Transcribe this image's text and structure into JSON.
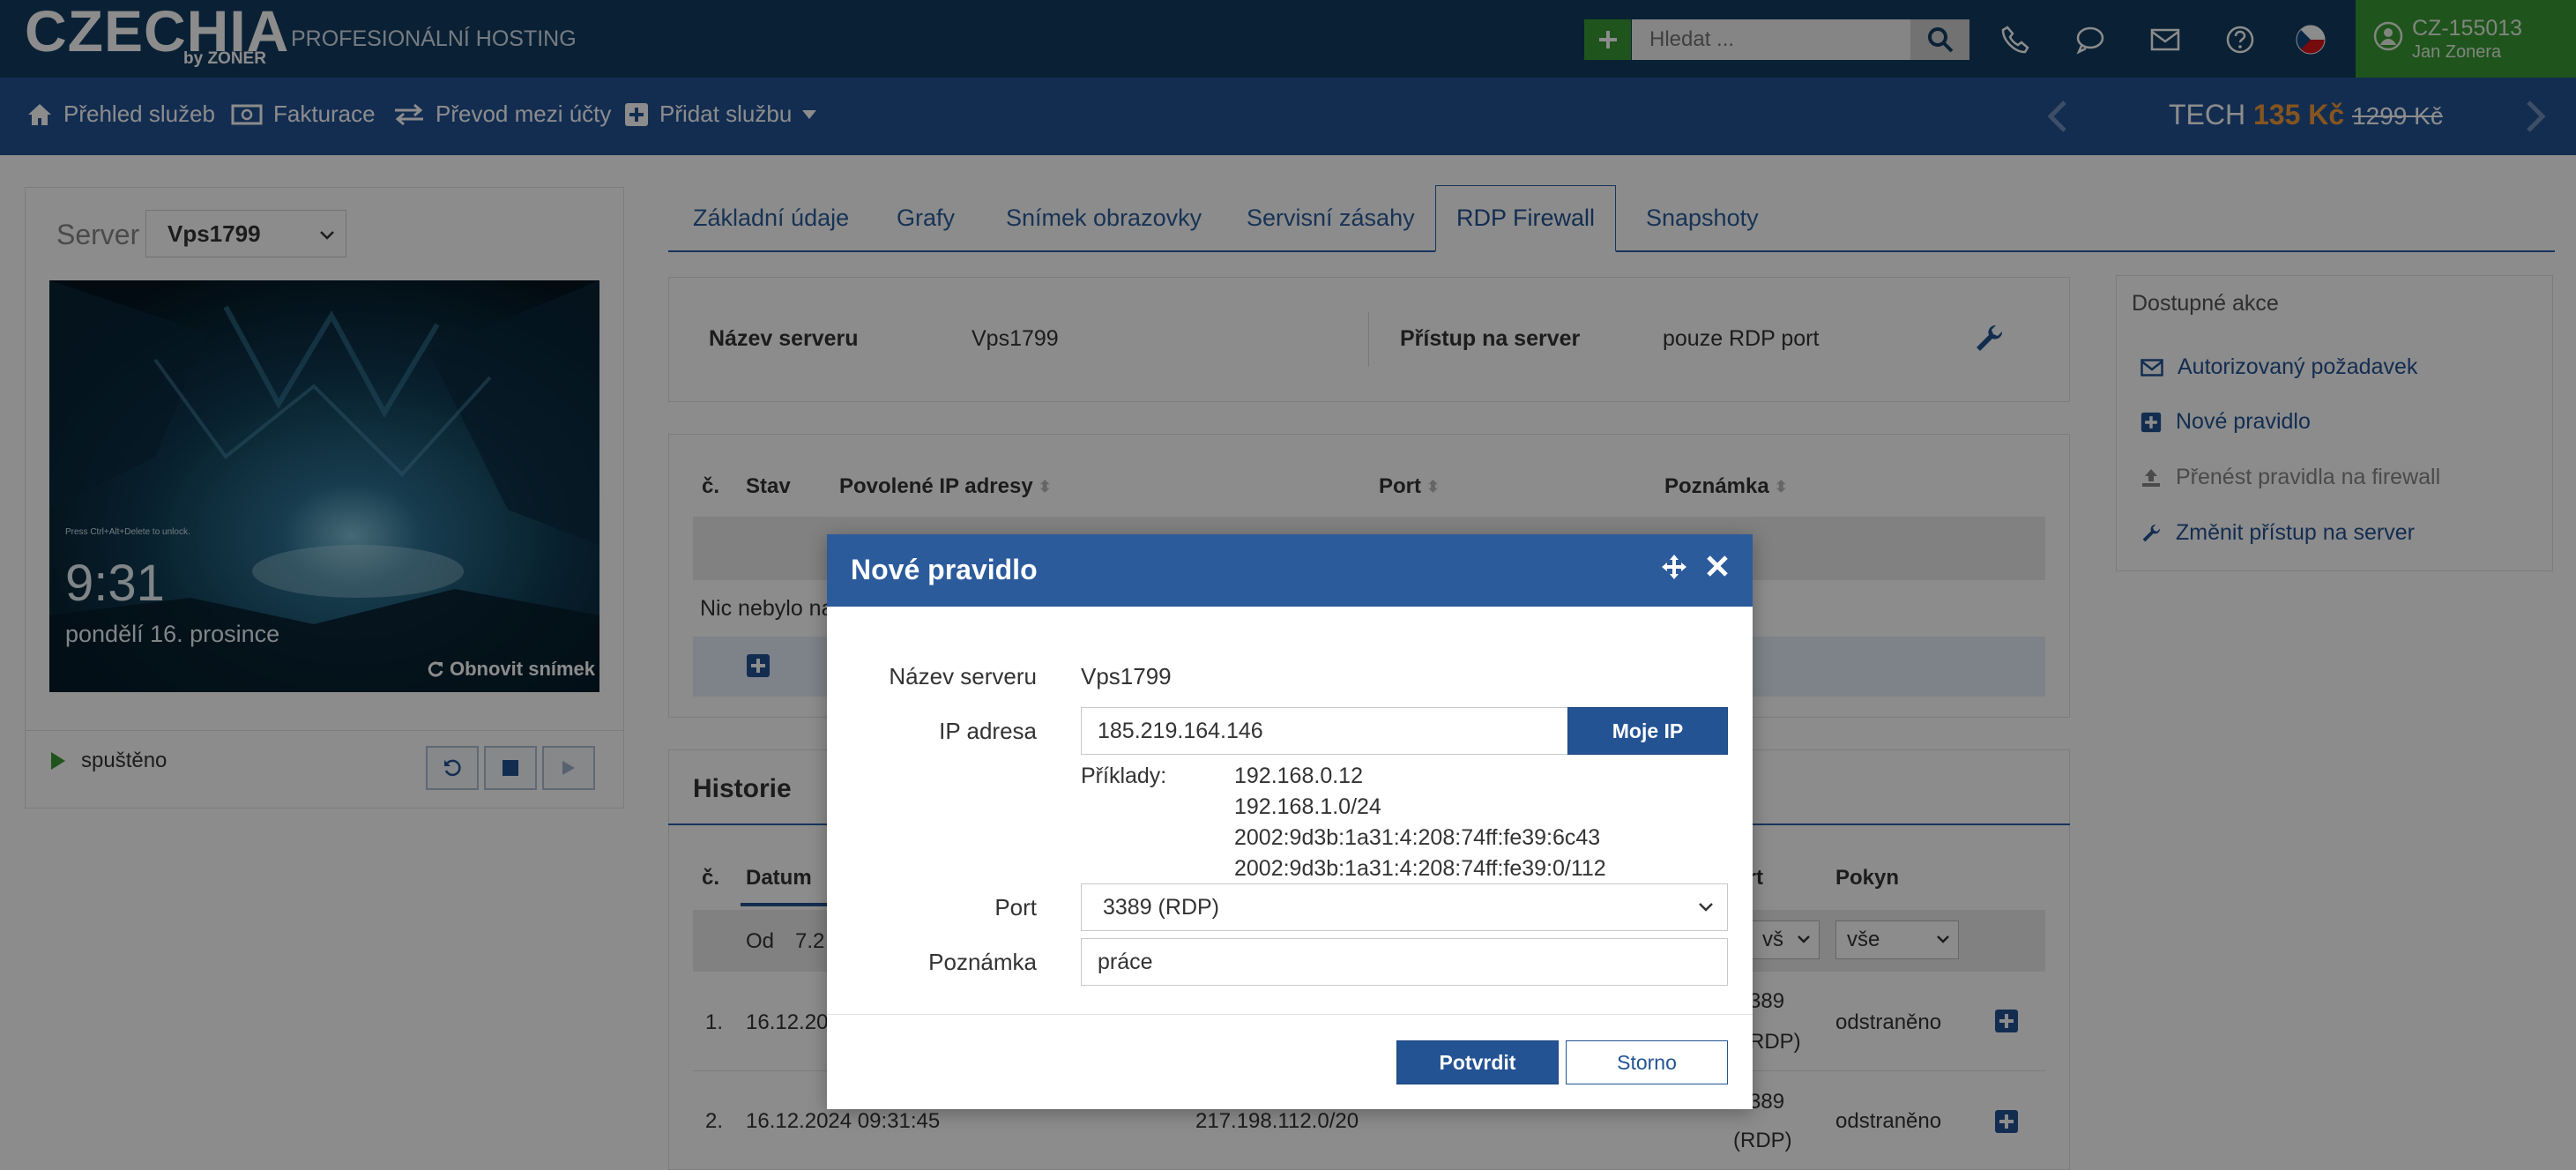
{
  "header": {
    "logo": "CZECHIA",
    "logo_sub": "by ZONER",
    "tagline": "PROFESIONÁLNÍ HOSTING",
    "search_placeholder": "Hledat ...",
    "account_id": "CZ-155013",
    "account_name": "Jan Zonera"
  },
  "nav": {
    "items": [
      {
        "label": "Přehled služeb",
        "icon": "home-icon"
      },
      {
        "label": "Fakturace",
        "icon": "money-icon"
      },
      {
        "label": "Převod mezi účty",
        "icon": "transfer-icon"
      },
      {
        "label": "Přidat službu",
        "icon": "plus-square-icon"
      }
    ],
    "tech_label": "TECH",
    "tech_price_new": "135 Kč",
    "tech_price_old": "1299 Kč"
  },
  "left": {
    "server_label": "Server",
    "server_value": "Vps1799",
    "screenshot_hint": "Press Ctrl+Alt+Delete to unlock.",
    "screenshot_time": "9:31",
    "screenshot_date": "pondělí 16. prosince",
    "refresh_label": "Obnovit snímek",
    "status": "spuštěno"
  },
  "tabs": [
    "Základní údaje",
    "Grafy",
    "Snímek obrazovky",
    "Servisní zásahy",
    "RDP Firewall",
    "Snapshoty"
  ],
  "info": {
    "server_name_label": "Název serveru",
    "server_name_value": "Vps1799",
    "access_label": "Přístup na server",
    "access_value": "pouze RDP port"
  },
  "rules": {
    "headers": [
      "č.",
      "Stav",
      "Povolené IP adresy",
      "Port",
      "Poznámka"
    ],
    "empty_text": "Nic nebylo na"
  },
  "history": {
    "title": "Historie",
    "headers": [
      "č.",
      "Datum",
      "ort",
      "Pokyn"
    ],
    "filter_from": "Od",
    "filter_date_partial": "7.2",
    "filter_port": "vš",
    "filter_action": "vše",
    "rows": [
      {
        "num": "1.",
        "date": "16.12.20",
        "port": "389",
        "port2": "RDP)",
        "action": "odstraněno"
      },
      {
        "num": "2.",
        "date": "16.12.2024 09:31:45",
        "ip": "217.198.112.0/20",
        "port": "389",
        "port2": "(RDP)",
        "action": "odstraněno"
      }
    ]
  },
  "actions": {
    "title": "Dostupné akce",
    "items": [
      {
        "label": "Autorizovaný požadavek",
        "icon": "envelope-icon",
        "enabled": true
      },
      {
        "label": "Nové pravidlo",
        "icon": "plus-square-icon",
        "enabled": true
      },
      {
        "label": "Přenést pravidla na firewall",
        "icon": "upload-icon",
        "enabled": false
      },
      {
        "label": "Změnit přístup na server",
        "icon": "wrench-icon",
        "enabled": true
      }
    ]
  },
  "modal": {
    "title": "Nové pravidlo",
    "server_name_label": "Název serveru",
    "server_name_value": "Vps1799",
    "ip_label": "IP adresa",
    "ip_value": "185.219.164.146",
    "my_ip_label": "Moje IP",
    "examples_label": "Příklady:",
    "examples": [
      "192.168.0.12",
      "192.168.1.0/24",
      "2002:9d3b:1a31:4:208:74ff:fe39:6c43",
      "2002:9d3b:1a31:4:208:74ff:fe39:0/112"
    ],
    "port_label": "Port",
    "port_value": "3389 (RDP)",
    "note_label": "Poznámka",
    "note_value": "práce",
    "confirm_label": "Potvrdit",
    "cancel_label": "Storno"
  },
  "colors": {
    "topbar": "#133d62",
    "navbar": "#245394",
    "accent_green": "#3a9a33",
    "price_orange": "#f29b3a"
  }
}
